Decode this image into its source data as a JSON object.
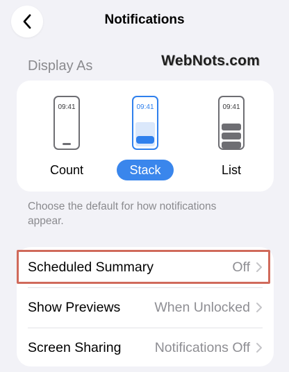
{
  "header": {
    "title": "Notifications",
    "back_icon": "chevron-left-icon"
  },
  "watermark": "WebNots.com",
  "display_as": {
    "section_title": "Display As",
    "options": [
      {
        "label": "Count",
        "time": "09:41",
        "selected": false
      },
      {
        "label": "Stack",
        "time": "09:41",
        "selected": true
      },
      {
        "label": "List",
        "time": "09:41",
        "selected": false
      }
    ],
    "footer": "Choose the default for how notifications appear."
  },
  "settings": {
    "rows": [
      {
        "label": "Scheduled Summary",
        "value": "Off"
      },
      {
        "label": "Show Previews",
        "value": "When Unlocked"
      },
      {
        "label": "Screen Sharing",
        "value": "Notifications Off"
      }
    ]
  },
  "colors": {
    "accent": "#3a86ec",
    "highlight_border": "#d06a5b",
    "background": "#f2f2f7",
    "secondary_text": "#8a8a8e"
  }
}
